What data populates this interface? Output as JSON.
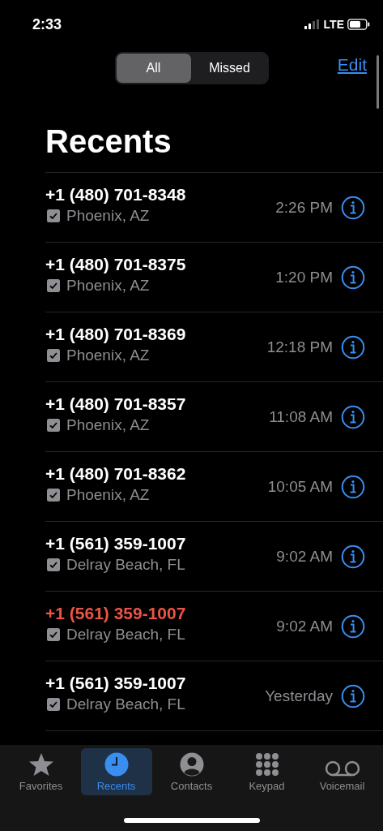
{
  "status_bar": {
    "time": "2:33",
    "network": "LTE"
  },
  "segments": [
    {
      "label": "All",
      "selected": true
    },
    {
      "label": "Missed",
      "selected": false
    }
  ],
  "edit_button": "Edit",
  "title": "Recents",
  "calls": [
    {
      "number": "+1 (480) 701-8348",
      "missed": false,
      "location": "Phoenix, AZ",
      "time": "2:26 PM"
    },
    {
      "number": "+1 (480) 701-8375",
      "missed": false,
      "location": "Phoenix, AZ",
      "time": "1:20 PM"
    },
    {
      "number": "+1 (480) 701-8369",
      "missed": false,
      "location": "Phoenix, AZ",
      "time": "12:18 PM"
    },
    {
      "number": "+1 (480) 701-8357",
      "missed": false,
      "location": "Phoenix, AZ",
      "time": "11:08 AM"
    },
    {
      "number": "+1 (480) 701-8362",
      "missed": false,
      "location": "Phoenix, AZ",
      "time": "10:05 AM"
    },
    {
      "number": "+1 (561) 359-1007",
      "missed": false,
      "location": "Delray Beach, FL",
      "time": "9:02 AM"
    },
    {
      "number": "+1 (561) 359-1007",
      "missed": true,
      "location": "Delray Beach, FL",
      "time": "9:02 AM"
    },
    {
      "number": "+1 (561) 359-1007",
      "missed": false,
      "location": "Delray Beach, FL",
      "time": "Yesterday"
    }
  ],
  "tab_bar": [
    {
      "kind": "favorites",
      "label": "Favorites",
      "selected": false
    },
    {
      "kind": "recents",
      "label": "Recents",
      "selected": true
    },
    {
      "kind": "contacts",
      "label": "Contacts",
      "selected": false
    },
    {
      "kind": "keypad",
      "label": "Keypad",
      "selected": false
    },
    {
      "kind": "voicemail",
      "label": "Voicemail",
      "selected": false
    }
  ]
}
